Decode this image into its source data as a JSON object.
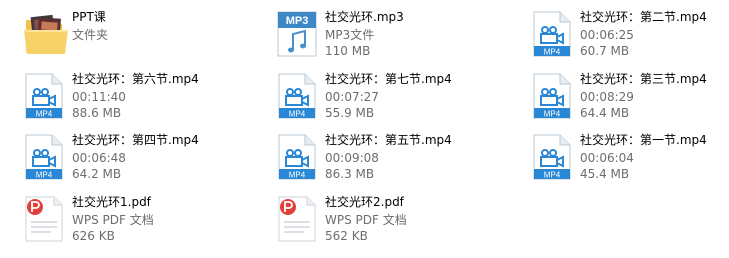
{
  "window": {
    "view": "tiles"
  },
  "files": [
    {
      "name": "PPT课",
      "type": "文件夹",
      "size": "",
      "icon": "folder-icon"
    },
    {
      "name": "社交光环.mp3",
      "type": "MP3文件",
      "size": "110 MB",
      "icon": "mp3-icon",
      "badge": "MP3"
    },
    {
      "name": "社交光环：第二节.mp4",
      "type": "00:06:25",
      "size": "60.7 MB",
      "icon": "mp4-icon",
      "badge": "MP4"
    },
    {
      "name": "社交光环：第六节.mp4",
      "type": "00:11:40",
      "size": "88.6 MB",
      "icon": "mp4-icon",
      "badge": "MP4"
    },
    {
      "name": "社交光环：第七节.mp4",
      "type": "00:07:27",
      "size": "55.9 MB",
      "icon": "mp4-icon",
      "badge": "MP4"
    },
    {
      "name": "社交光环：第三节.mp4",
      "type": "00:08:29",
      "size": "64.4 MB",
      "icon": "mp4-icon",
      "badge": "MP4"
    },
    {
      "name": "社交光环：第四节.mp4",
      "type": "00:06:48",
      "size": "64.2 MB",
      "icon": "mp4-icon",
      "badge": "MP4"
    },
    {
      "name": "社交光环：第五节.mp4",
      "type": "00:09:08",
      "size": "86.3 MB",
      "icon": "mp4-icon",
      "badge": "MP4"
    },
    {
      "name": "社交光环：第一节.mp4",
      "type": "00:06:04",
      "size": "45.4 MB",
      "icon": "mp4-icon",
      "badge": "MP4"
    },
    {
      "name": "社交光环1.pdf",
      "type": "WPS PDF 文档",
      "size": "626 KB",
      "icon": "wps-pdf-icon"
    },
    {
      "name": "社交光环2.pdf",
      "type": "WPS PDF 文档",
      "size": "562 KB",
      "icon": "wps-pdf-icon"
    }
  ],
  "colors": {
    "video_badge": "#2a87d6",
    "mp3_badge": "#3c88c6",
    "pdf_red": "#e0413a",
    "folder_yellow": "#f3c24a",
    "meta_text": "#6d6d6d"
  }
}
